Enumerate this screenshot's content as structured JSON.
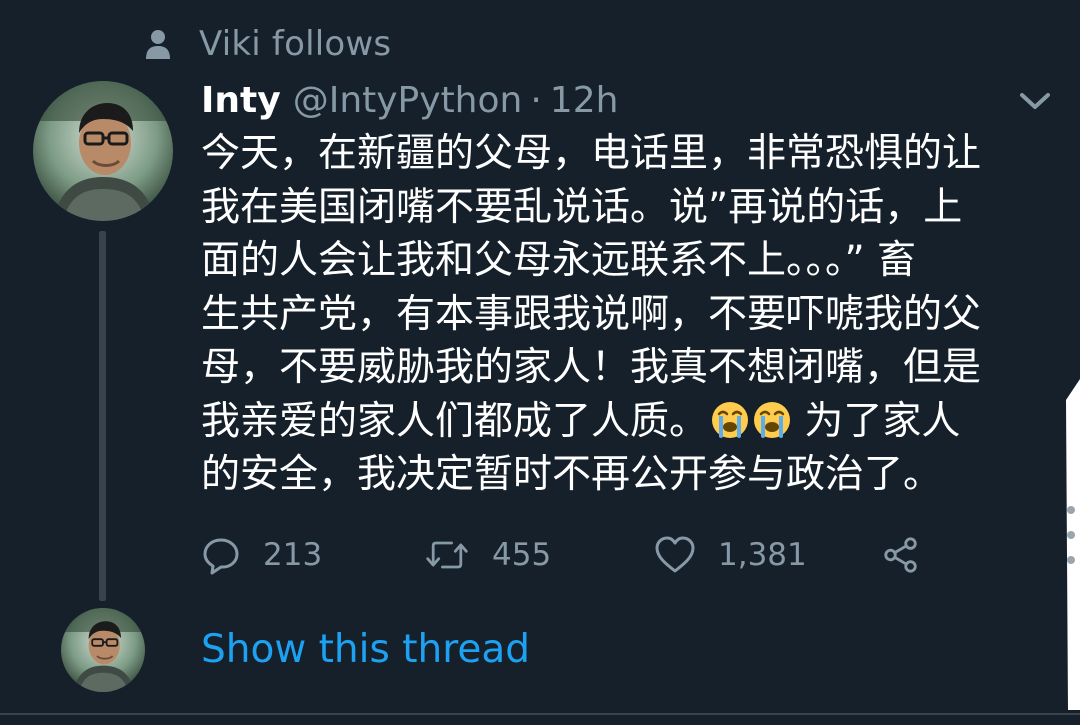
{
  "social_context": {
    "text": "Viki follows",
    "icon": "person-icon"
  },
  "tweet": {
    "display_name": "Inty",
    "handle": "@IntyPython",
    "separator": "·",
    "time": "12h",
    "text_lines": [
      "今天，在新疆的父母，电话里，非常恐惧的让",
      "我在美国闭嘴不要乱说话。说”再说的话，上",
      "面的人会让我和父母永远联系不上。。。” 畜",
      "生共产党，有本事跟我说啊，不要吓唬我的父",
      "母，不要威胁我的家人！我真不想闭嘴，但是",
      "我亲爱的家人们都成了人质。",
      " 为了家人",
      "的安全，我决定暂时不再公开参与政治了。"
    ],
    "emoji": [
      "loudly-crying-face-emoji",
      "loudly-crying-face-emoji"
    ],
    "actions": {
      "reply": {
        "icon": "reply-icon",
        "count": "213"
      },
      "retweet": {
        "icon": "retweet-icon",
        "count": "455"
      },
      "like": {
        "icon": "heart-icon",
        "count": "1,381"
      },
      "share": {
        "icon": "share-icon"
      }
    },
    "menu_icon": "chevron-down-icon"
  },
  "thread": {
    "show_label": "Show this thread"
  },
  "colors": {
    "background": "#15202b",
    "secondary_text": "#8899a6",
    "primary_text": "#ffffff",
    "link": "#1da1f2",
    "line": "#38444d"
  }
}
